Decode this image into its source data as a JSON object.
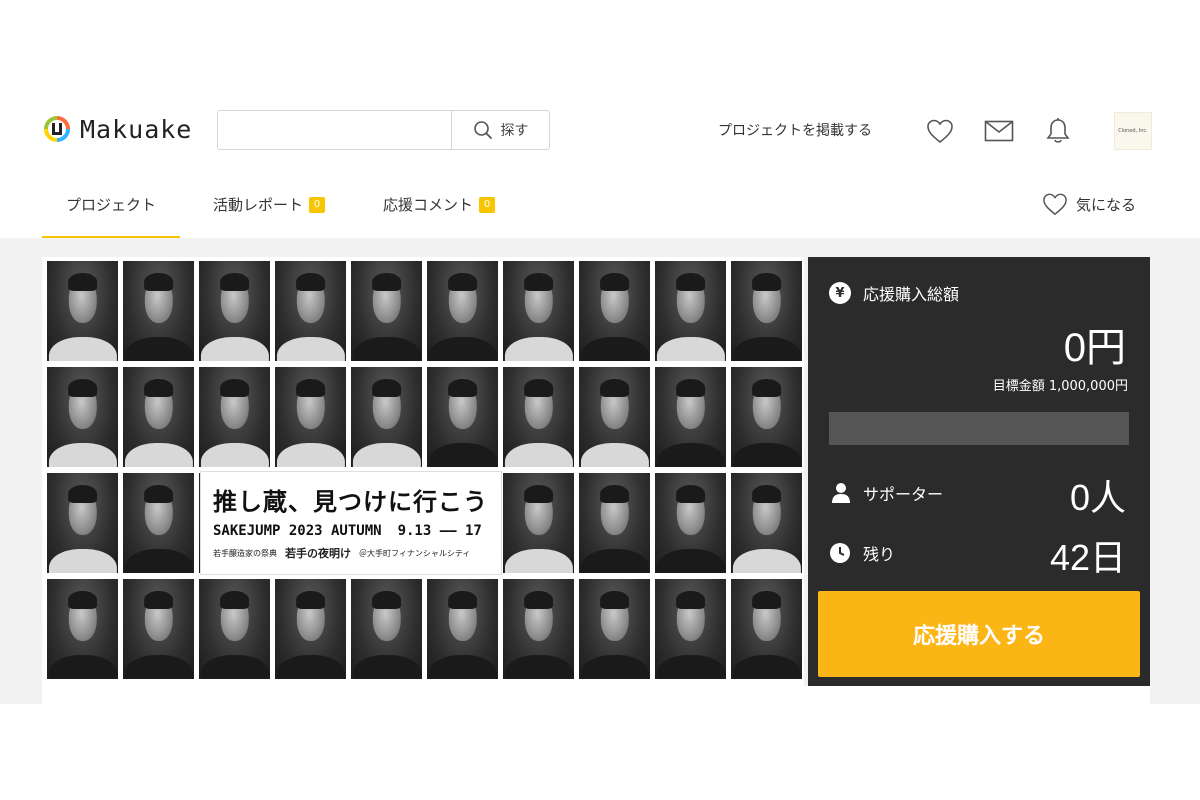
{
  "header": {
    "logo_text": "Makuake",
    "search": {
      "placeholder": "",
      "button_label": "探す"
    },
    "post_project_label": "プロジェクトを掲載する",
    "icons": [
      "heart-icon",
      "mail-icon",
      "bell-icon"
    ],
    "avatar_text": "Cloned, Inc."
  },
  "tabs": [
    {
      "label": "プロジェクト",
      "active": true
    },
    {
      "label": "活動レポート",
      "count": "0"
    },
    {
      "label": "応援コメント",
      "count": "0"
    }
  ],
  "favorite_label": "気になる",
  "banner": {
    "title": "推し蔵、見つけに行こう",
    "event": "SAKEJUMP 2023 AUTUMN",
    "dates": "9.13 —— 17",
    "sub_small": "若手醸造家の祭典",
    "sub_big": "若手の夜明け",
    "sub_venue": "＠大手町フィナンシャルシティ"
  },
  "panel": {
    "total_label": "応援購入総額",
    "total_value": "0円",
    "goal_text": "目標金額 1,000,000円",
    "progress": 0,
    "supporters_label": "サポーター",
    "supporters_value": "0人",
    "remaining_label": "残り",
    "remaining_value": "42日",
    "cta_label": "応援購入する"
  },
  "colors": {
    "accent_yellow": "#f7c600",
    "cta_orange": "#fbb515",
    "progress_green": "#b6f52c",
    "panel_bg": "#2b2b2b"
  }
}
